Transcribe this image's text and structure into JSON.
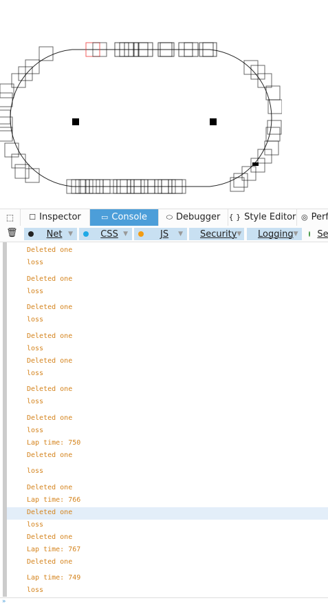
{
  "devtools": {
    "tabs": [
      {
        "label": "Inspector",
        "icon": "inspector-icon"
      },
      {
        "label": "Console",
        "icon": "console-icon",
        "active": true
      },
      {
        "label": "Debugger",
        "icon": "debugger-icon"
      },
      {
        "label": "Style Editor",
        "icon": "style-editor-icon"
      },
      {
        "label": "Perf",
        "icon": "performance-icon"
      }
    ],
    "filters": [
      {
        "label": "Net",
        "color": "#222222"
      },
      {
        "label": "CSS",
        "color": "#1fa9e6"
      },
      {
        "label": "JS",
        "color": "#f39c12"
      },
      {
        "label": "Security",
        "color": "#e53935"
      },
      {
        "label": "Logging",
        "color": "#999999"
      },
      {
        "label": "Ser",
        "color": "#4a9a4a"
      }
    ]
  },
  "console": {
    "messages": [
      "Deleted one",
      "loss",
      "Deleted one",
      "loss",
      "Deleted one",
      "loss",
      "Deleted one",
      "loss",
      "Deleted one",
      "loss",
      "Deleted one",
      "loss",
      "Deleted one",
      "loss",
      "Lap time: 750",
      "Deleted one",
      "loss",
      "Deleted one",
      "Lap time: 766",
      "Deleted one",
      "loss",
      "Deleted one",
      "Lap time: 767",
      "Deleted one",
      "Lap time: 749",
      "loss"
    ],
    "input_prompt": "»"
  },
  "colors": {
    "console_text": "#d4831c",
    "highlight": "#e3eef9",
    "active_tab": "#4c9ed9"
  }
}
